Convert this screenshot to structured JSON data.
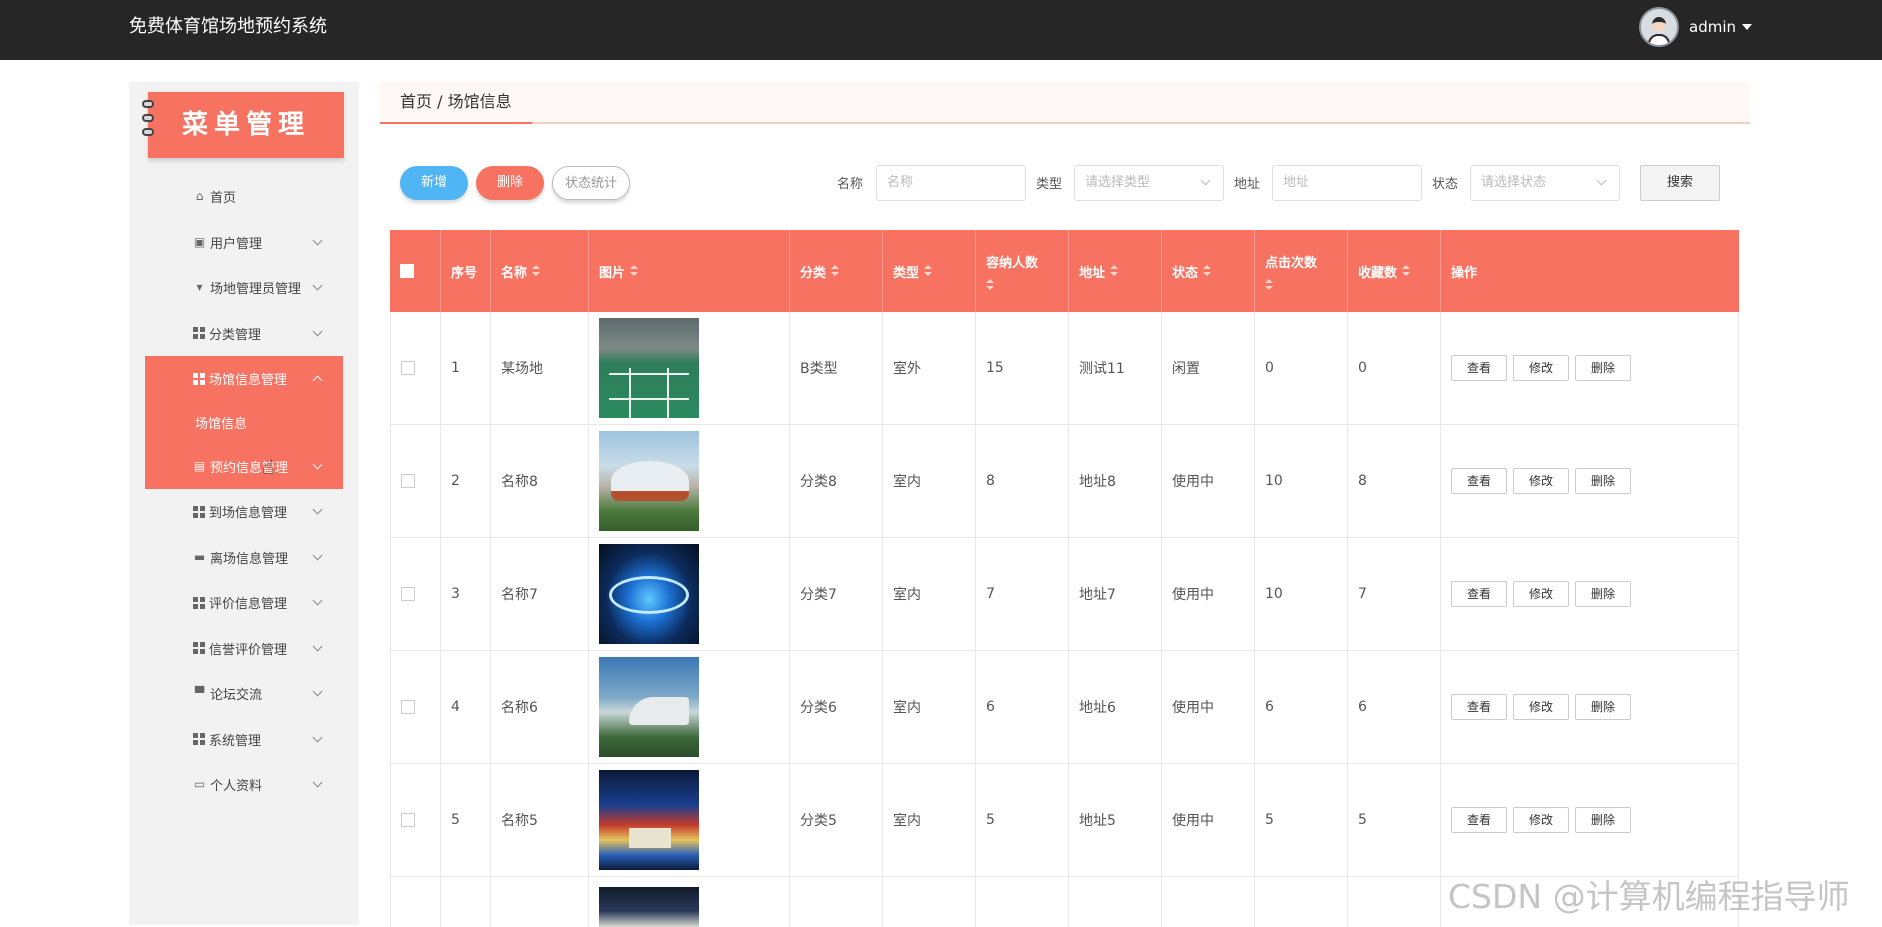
{
  "app": {
    "title": "免费体育馆场地预约系统"
  },
  "user": {
    "name": "admin"
  },
  "sidebar": {
    "banner": "菜单管理",
    "items": [
      {
        "label": "首页",
        "icon": "home-icon"
      },
      {
        "label": "用户管理",
        "icon": "user-icon"
      },
      {
        "label": "场地管理员管理",
        "icon": "badge-icon"
      },
      {
        "label": "分类管理",
        "icon": "grid-icon"
      },
      {
        "label": "场馆信息管理",
        "icon": "grid-icon",
        "active": true
      },
      {
        "label": "场馆信息",
        "sub": true
      },
      {
        "label": "预约信息管理",
        "icon": "chart-icon",
        "hover": true
      },
      {
        "label": "到场信息管理",
        "icon": "grid-icon"
      },
      {
        "label": "离场信息管理",
        "icon": "briefcase-icon"
      },
      {
        "label": "评价信息管理",
        "icon": "grid-icon"
      },
      {
        "label": "信誉评价管理",
        "icon": "grid-icon"
      },
      {
        "label": "论坛交流",
        "icon": "printer-icon"
      },
      {
        "label": "系统管理",
        "icon": "grid-icon"
      },
      {
        "label": "个人资料",
        "icon": "card-icon"
      }
    ]
  },
  "breadcrumb": {
    "text": "首页 / 场馆信息"
  },
  "toolbar": {
    "add_label": "新增",
    "delete_label": "删除",
    "stats_label": "状态统计",
    "name_label": "名称",
    "name_placeholder": "名称",
    "type_label": "类型",
    "type_placeholder": "请选择类型",
    "address_label": "地址",
    "address_placeholder": "地址",
    "status_label": "状态",
    "status_placeholder": "请选择状态",
    "search_label": "搜索"
  },
  "table": {
    "headers": [
      "序号",
      "名称",
      "图片",
      "分类",
      "类型",
      "容纳人数",
      "地址",
      "状态",
      "点击次数",
      "收藏数",
      "操作"
    ],
    "actions": [
      "查看",
      "修改",
      "删除"
    ],
    "rows": [
      {
        "no": "1",
        "name": "某场地",
        "category": "B类型",
        "type": "室外",
        "capacity": "15",
        "address": "测试11",
        "status": "闲置",
        "clicks": "0",
        "favorites": "0"
      },
      {
        "no": "2",
        "name": "名称8",
        "category": "分类8",
        "type": "室内",
        "capacity": "8",
        "address": "地址8",
        "status": "使用中",
        "clicks": "10",
        "favorites": "8"
      },
      {
        "no": "3",
        "name": "名称7",
        "category": "分类7",
        "type": "室内",
        "capacity": "7",
        "address": "地址7",
        "status": "使用中",
        "clicks": "10",
        "favorites": "7"
      },
      {
        "no": "4",
        "name": "名称6",
        "category": "分类6",
        "type": "室内",
        "capacity": "6",
        "address": "地址6",
        "status": "使用中",
        "clicks": "6",
        "favorites": "6"
      },
      {
        "no": "5",
        "name": "名称5",
        "category": "分类5",
        "type": "室内",
        "capacity": "5",
        "address": "地址5",
        "status": "使用中",
        "clicks": "5",
        "favorites": "5"
      }
    ]
  },
  "watermark": "CSDN @计算机编程指导师",
  "colors": {
    "accent": "#f77261",
    "topbar": "#262626",
    "add_button": "#4fb5f5"
  }
}
